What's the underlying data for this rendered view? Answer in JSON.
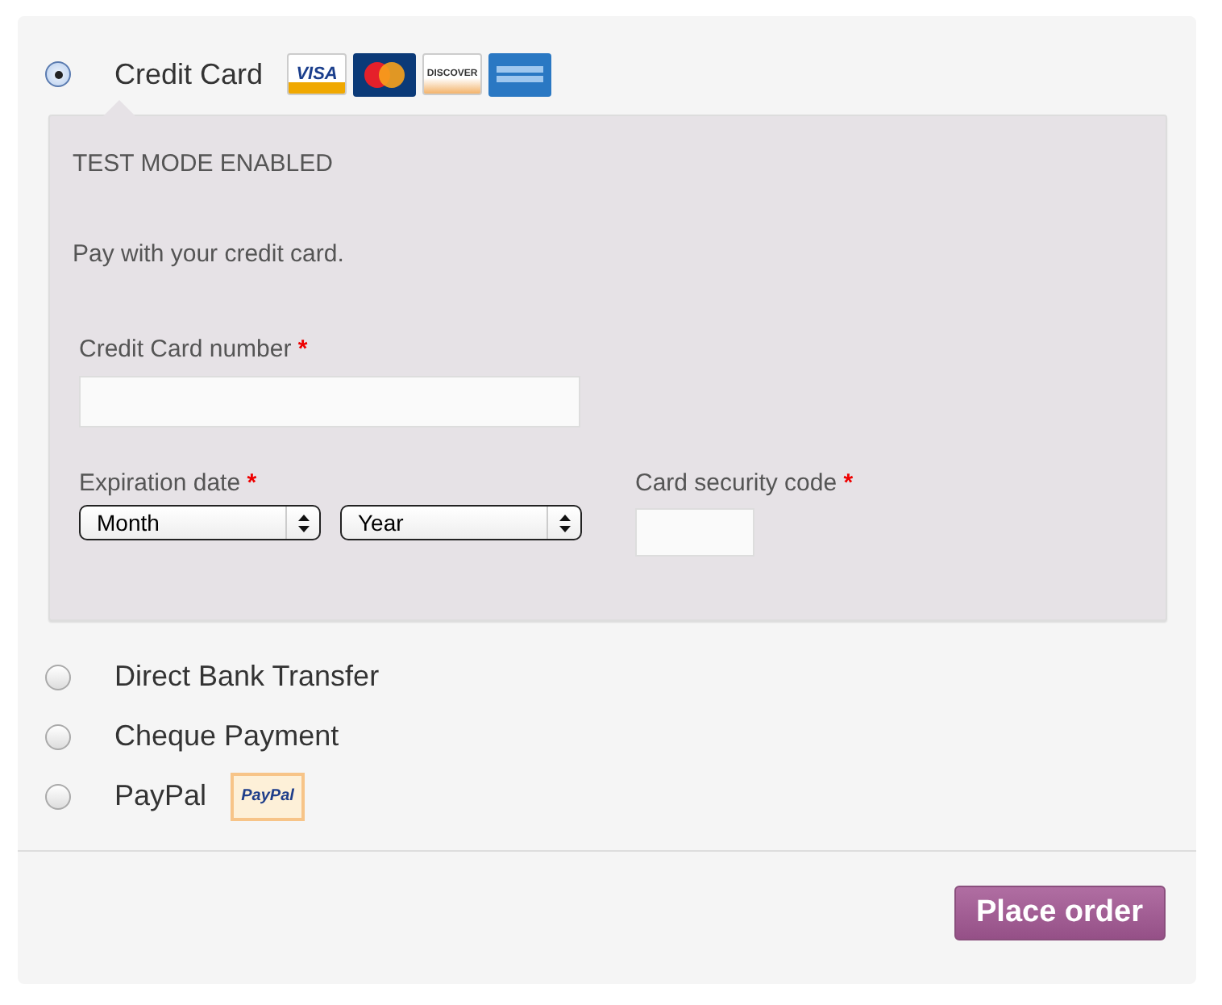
{
  "payment_methods": [
    {
      "label": "Credit Card",
      "selected": true,
      "logos": [
        {
          "kind": "visa",
          "text": "VISA"
        },
        {
          "kind": "mastercard"
        },
        {
          "kind": "discover",
          "text": "DISCOVER"
        },
        {
          "kind": "amex"
        }
      ]
    },
    {
      "label": "Direct Bank Transfer",
      "selected": false
    },
    {
      "label": "Cheque Payment",
      "selected": false
    },
    {
      "label": "PayPal",
      "selected": false,
      "logos": [
        {
          "kind": "paypal",
          "text": "PayPal"
        }
      ]
    }
  ],
  "card_panel": {
    "notice": "TEST MODE ENABLED",
    "description": "Pay with your credit card.",
    "card_number": {
      "label": "Credit Card number",
      "required": "*"
    },
    "expiration": {
      "label": "Expiration date",
      "required": "*",
      "selects": [
        {
          "value": "Month"
        },
        {
          "value": "Year"
        }
      ]
    },
    "security_code": {
      "label": "Card security code",
      "required": "*"
    }
  },
  "place_order": "Place order"
}
